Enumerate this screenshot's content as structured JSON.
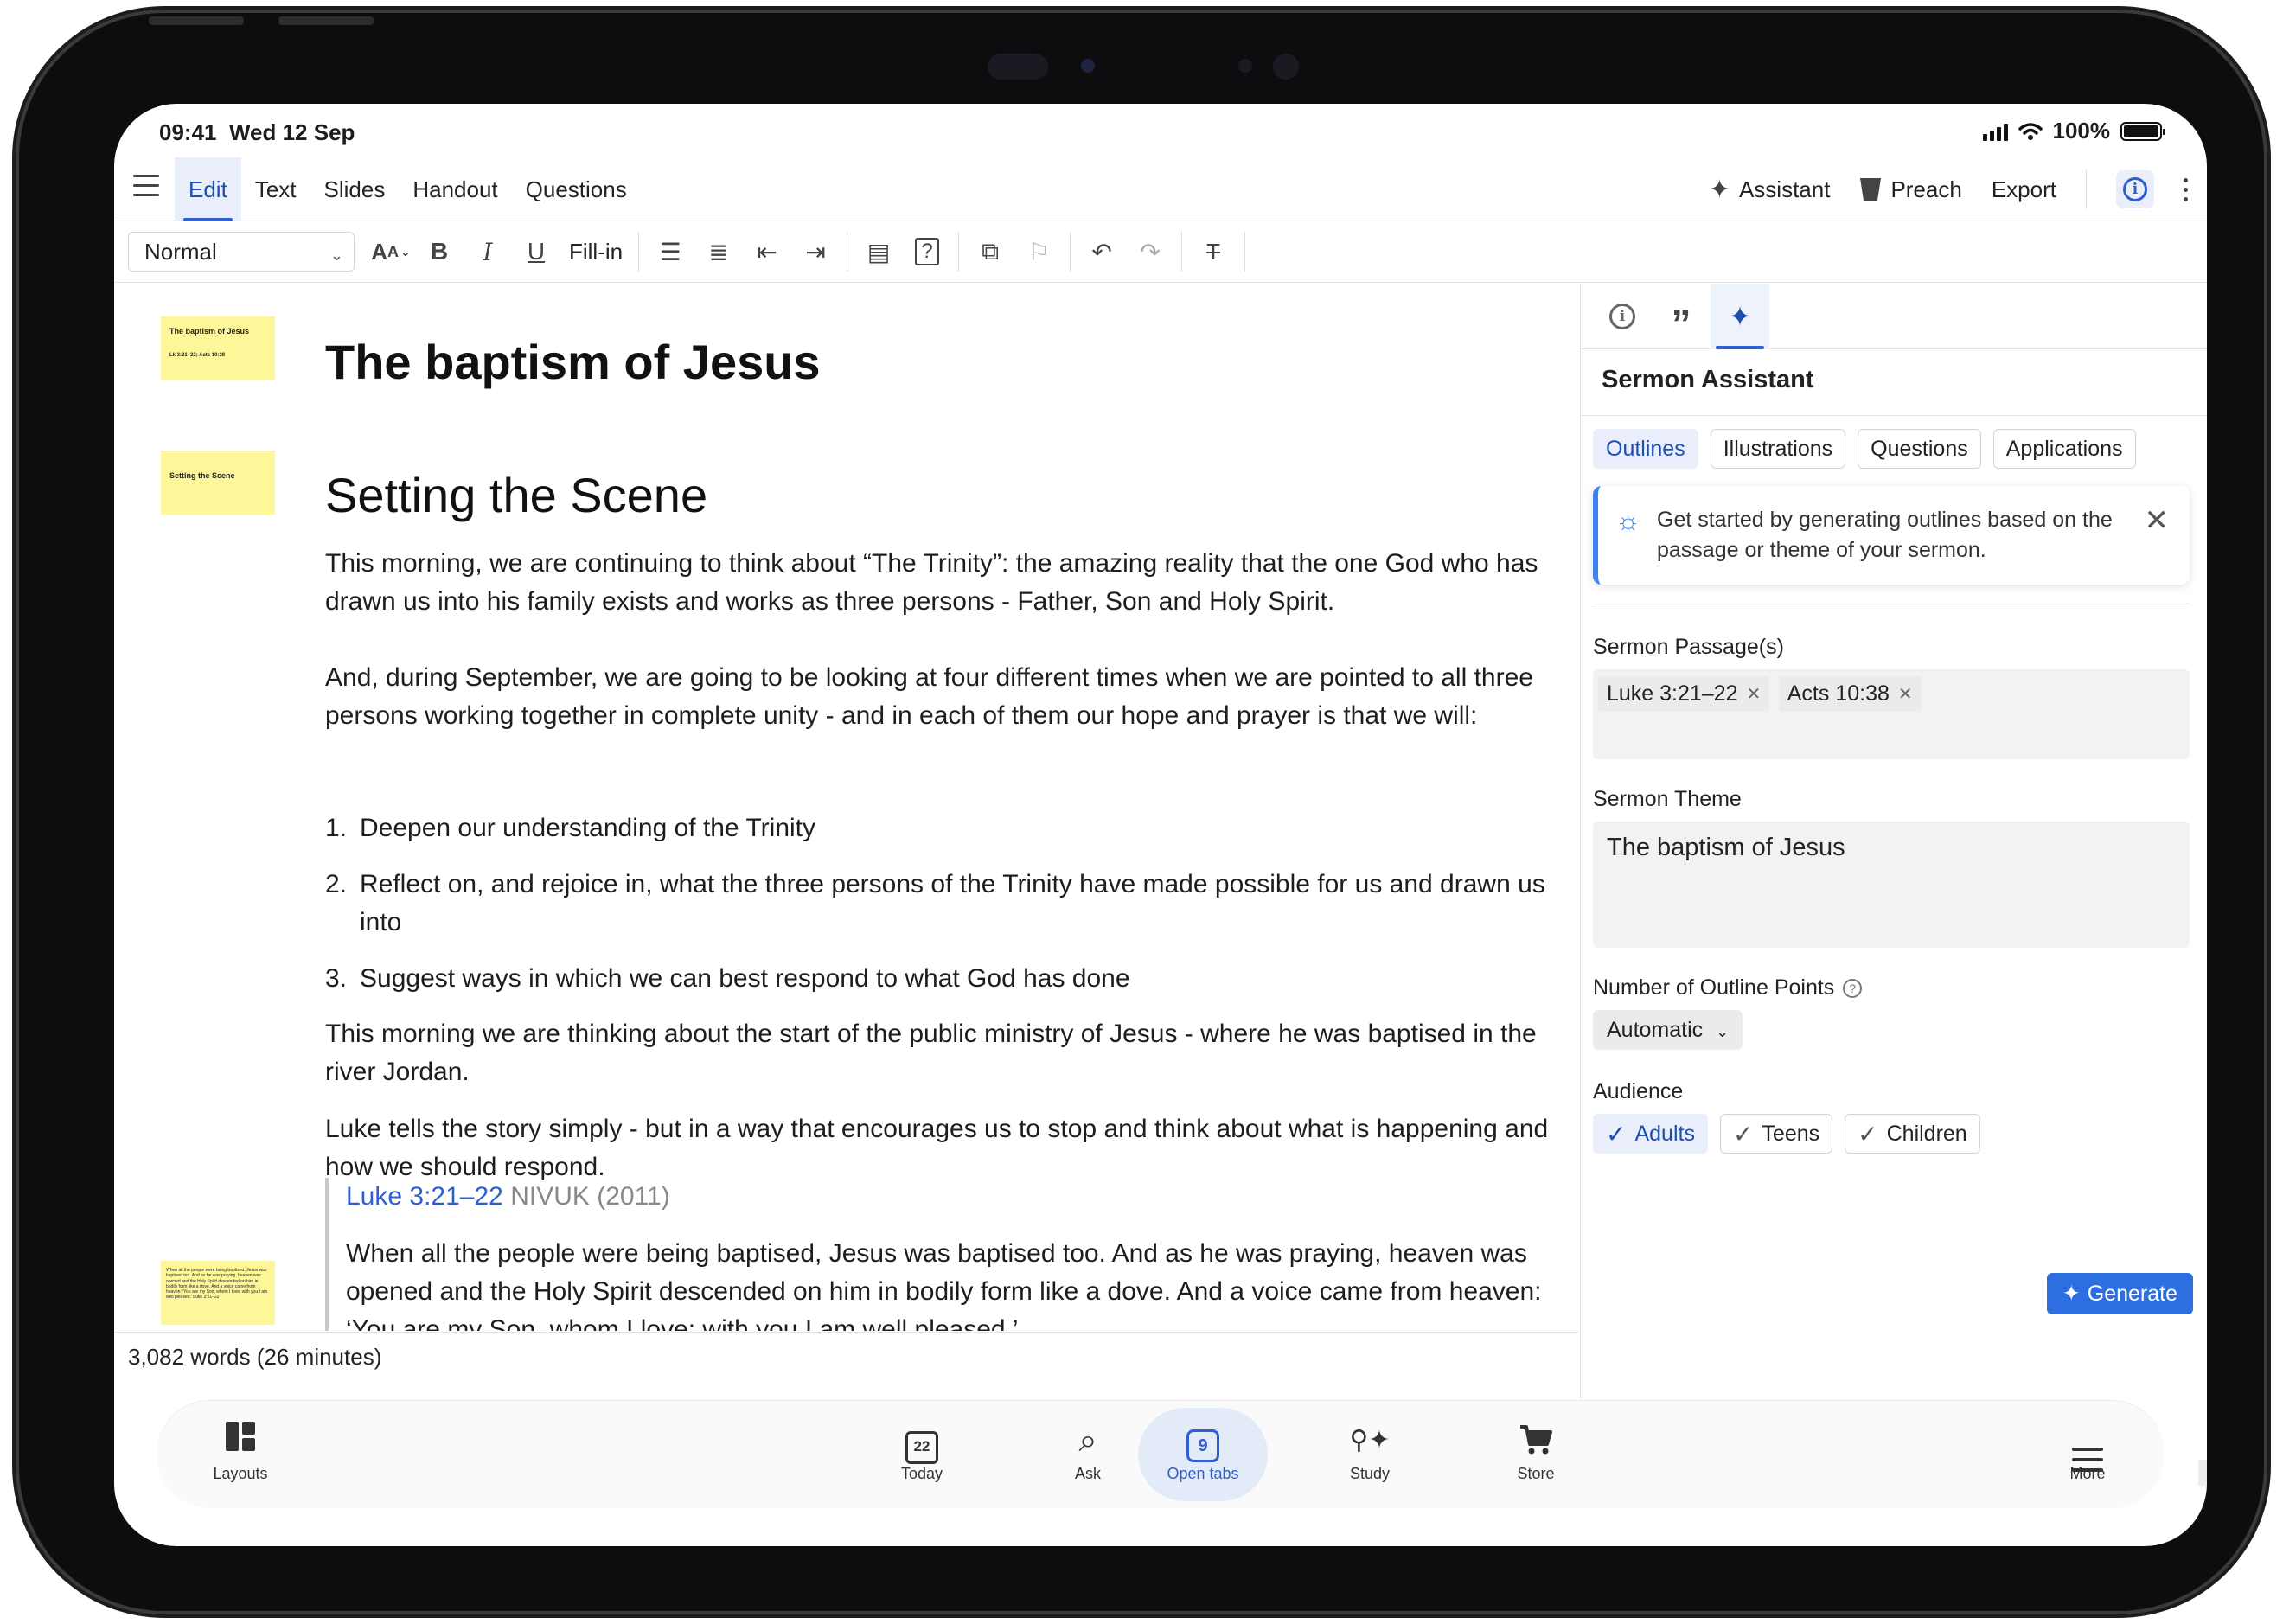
{
  "status": {
    "time": "09:41",
    "date": "Wed 12 Sep",
    "battery": "100%"
  },
  "menu": {
    "tabs": [
      "Edit",
      "Text",
      "Slides",
      "Handout",
      "Questions"
    ],
    "assistant": "Assistant",
    "preach": "Preach",
    "export": "Export"
  },
  "toolbar": {
    "style": "Normal",
    "fillin": "Fill-in"
  },
  "thumbs": {
    "t1_title": "The baptism of Jesus",
    "t1_sub": "Lk 3:21–22; Acts 10:38",
    "t2_title": "Setting the Scene",
    "t3_text": "When all the people were being baptised, Jesus was baptised too. And as he was praying, heaven was opened and the Holy Spirit descended on him in bodily form like a dove. And a voice came from heaven: 'You are my Son, whom I love; with you I am well pleased.' Luke 3:21–22"
  },
  "doc": {
    "title": "The baptism of Jesus",
    "heading": "Setting the Scene",
    "p1": "This morning, we are continuing to think about “The Trinity”: the amazing reality that the one God who has drawn us into his family exists and works as three persons - Father, Son and Holy Spirit.",
    "p2": "And, during September, we are going to be looking at four different times when we are pointed to all three persons working together in complete unity - and in each of them our hope and prayer is that we will:",
    "list": [
      {
        "n": "1.",
        "text": "Deepen our understanding of the Trinity"
      },
      {
        "n": "2.",
        "text": "Reflect on, and rejoice in, what the three persons of the Trinity have made possible for us and drawn us into"
      },
      {
        "n": "3.",
        "text": "Suggest ways in which we can best respond to what God has done"
      }
    ],
    "p3": "This morning we are thinking about the start of the public ministry of Jesus - where he was  baptised in the river Jordan.",
    "p4": "Luke tells the story simply - but in a way that encourages us to stop and think about what is happening and how we should respond.",
    "quote_ref": "Luke 3:21–22",
    "quote_version": "NIVUK (2011)",
    "quote_text": "When all the people were being baptised, Jesus was baptised too. And as he was praying, heaven was opened and the Holy Spirit descended on him in bodily form like a dove. And a voice came from heaven: ‘You are my Son, whom I love; with you I am well pleased.’",
    "wordcount": "3,082 words (26 minutes)"
  },
  "panel": {
    "title": "Sermon Assistant",
    "chips": [
      "Outlines",
      "Illustrations",
      "Questions",
      "Applications"
    ],
    "tip": "Get started by generating outlines based on the passage or theme of your sermon.",
    "passages_label": "Sermon Passage(s)",
    "passages": [
      "Luke 3:21–22",
      "Acts 10:38"
    ],
    "theme_label": "Sermon Theme",
    "theme_value": "The baptism of Jesus",
    "points_label": "Number of Outline Points",
    "points_value": "Automatic",
    "audience_label": "Audience",
    "audience": [
      "Adults",
      "Teens",
      "Children"
    ],
    "generate": "Generate"
  },
  "tabbar": {
    "layouts": "Layouts",
    "today": "Today",
    "today_day": "22",
    "ask": "Ask",
    "open_tabs": "Open tabs",
    "open_count": "9",
    "study": "Study",
    "store": "Store",
    "more": "More"
  },
  "colors": {
    "accent": "#2d5fd3",
    "highlight": "#fdf79a",
    "generate": "#2d6fe0"
  }
}
